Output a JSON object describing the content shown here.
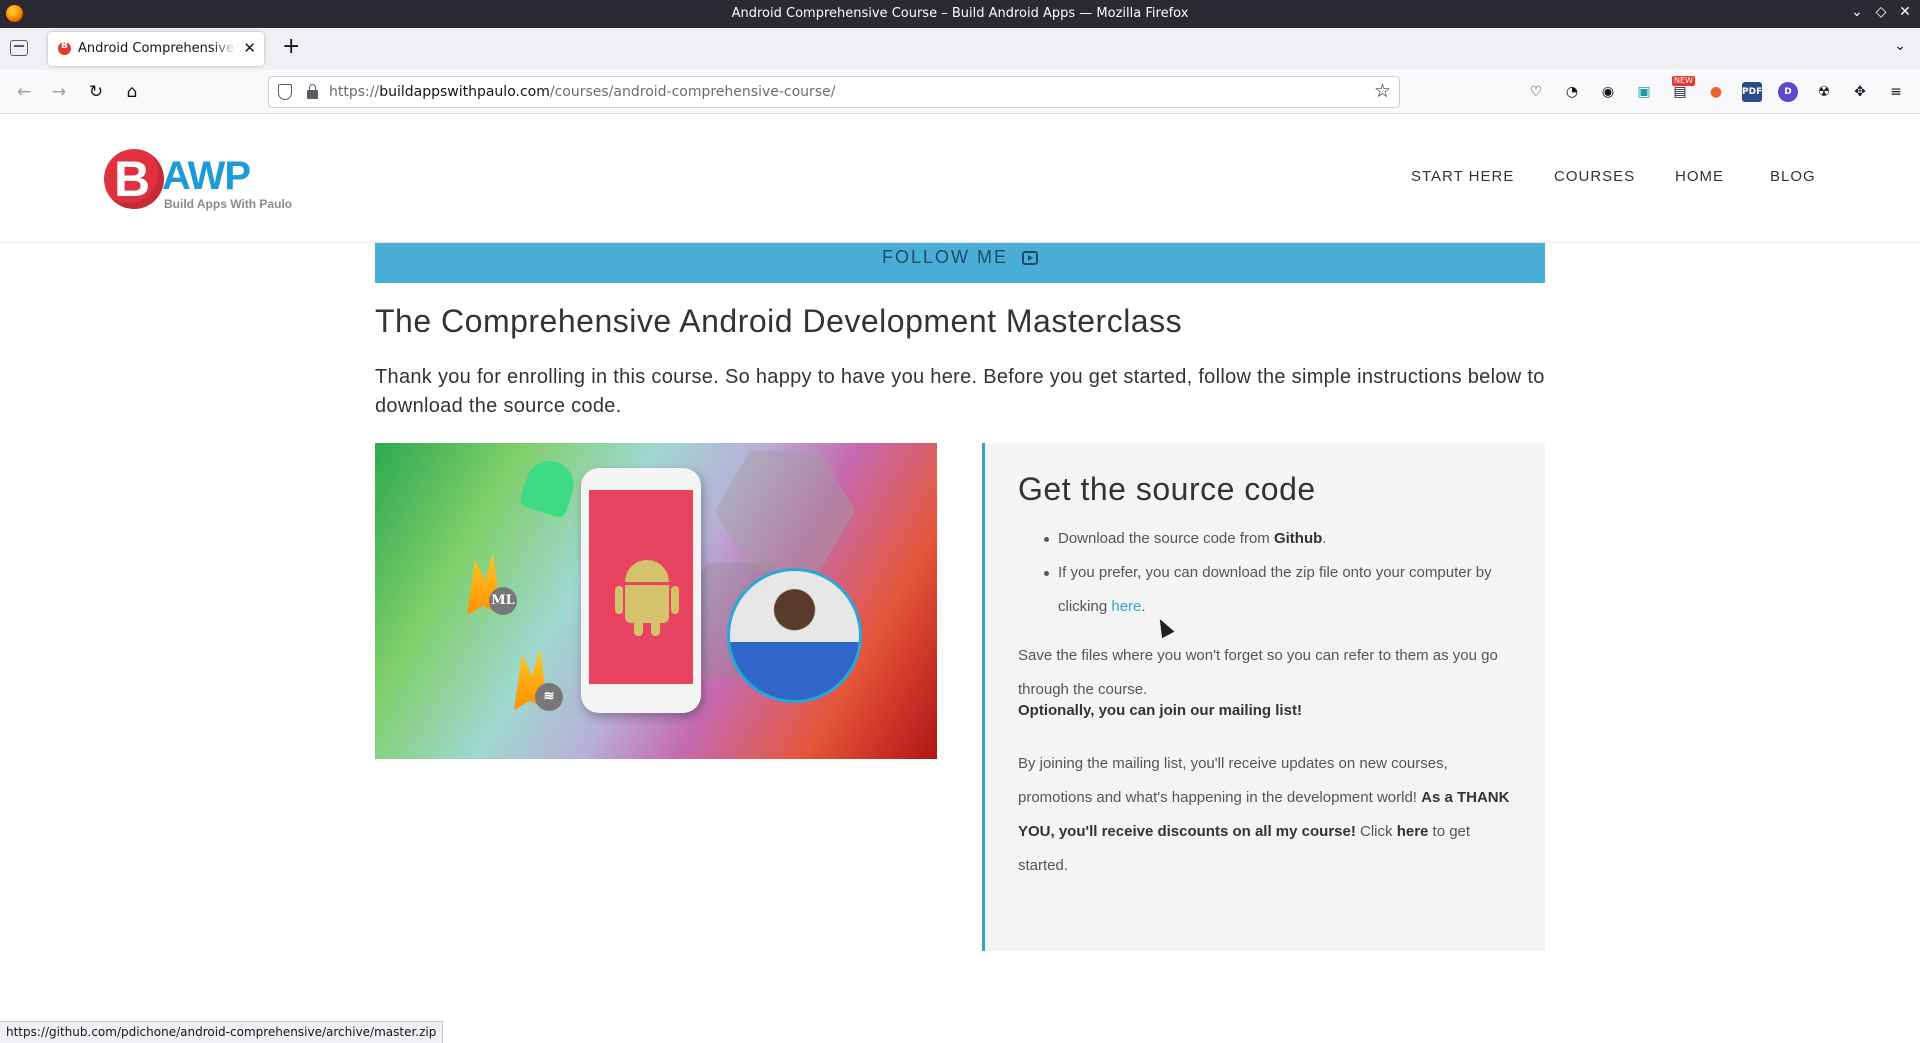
{
  "window": {
    "title": "Android Comprehensive Course – Build Android Apps — Mozilla Firefox"
  },
  "tabs": [
    {
      "label": "Android Comprehensive Course – Build Android Apps",
      "active": true
    }
  ],
  "urlbar": {
    "scheme": "https://",
    "host": "buildappswithpaulo.com",
    "path": "/courses/android-comprehensive-course/"
  },
  "toolbar_icons": [
    "pocket-icon",
    "timer-icon",
    "account-icon",
    "save-icon",
    "new-extension-icon",
    "duckduckgo-icon",
    "pdf-icon",
    "d-extension-icon",
    "radiation-icon",
    "extensions-icon",
    "menu-icon"
  ],
  "toolbar_badges": {
    "new": "NEW",
    "pdf": "PDF",
    "d": "D"
  },
  "site": {
    "logo": {
      "letter": "B",
      "text": "AWP",
      "tagline": "Build Apps With Paulo"
    },
    "nav": [
      "START HERE",
      "COURSES",
      "HOME",
      "BLOG"
    ],
    "follow_label": "FOLLOW ME",
    "course_title": "The Comprehensive Android Development Masterclass",
    "intro": "Thank you for enrolling in this course. So happy to have you here. Before you get started, follow the simple instructions below to download the source code.",
    "image_chips": [
      "ML",
      "≋"
    ],
    "source": {
      "heading": "Get the source code",
      "bullet1_prefix": "Download the source code from ",
      "bullet1_link": "Github",
      "bullet1_suffix": ".",
      "bullet2_prefix": "If you prefer, you can download the zip file onto your computer by clicking ",
      "bullet2_link": "here",
      "bullet2_suffix": ".",
      "save_text": "Save the files where you won't forget so you can refer to them as you go through the course.",
      "optional_bold": "Optionally,",
      "optional_strong": "you can join our mailing list",
      "optional_suffix": "!",
      "mailing_prefix": "By joining the mailing list, you'll receive updates on new courses, promotions and what's happening in the development world! ",
      "mailing_bold": "As a THANK YOU, you'll receive discounts on all my course!",
      "mailing_mid": " Click ",
      "mailing_link": "here",
      "mailing_suffix": " to get started."
    }
  },
  "status_url": "https://github.com/pdichone/android-comprehensive/archive/master.zip",
  "colors": {
    "accent": "#2ea3d8",
    "follow_bar": "#4aaed6",
    "brand_red": "#e0313e"
  }
}
